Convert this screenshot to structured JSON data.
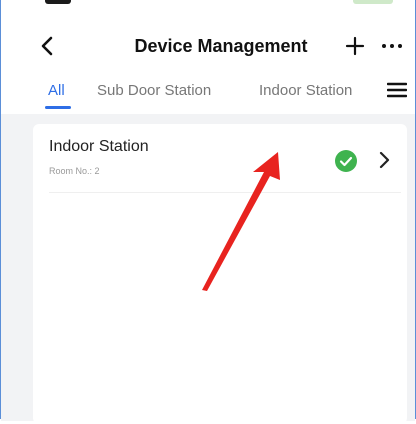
{
  "header": {
    "title": "Device Management"
  },
  "tabs": [
    {
      "label": "All",
      "active": true
    },
    {
      "label": "Sub Door Station",
      "active": false
    },
    {
      "label": "Indoor Station",
      "active": false
    }
  ],
  "devices": [
    {
      "name": "Indoor Station",
      "detail": "Room No.: 2",
      "status": "online",
      "status_icon": "check-circle-icon",
      "status_color": "#3fb34f"
    }
  ],
  "colors": {
    "accent": "#2e6ee6",
    "annotation_arrow": "#e8231f"
  }
}
